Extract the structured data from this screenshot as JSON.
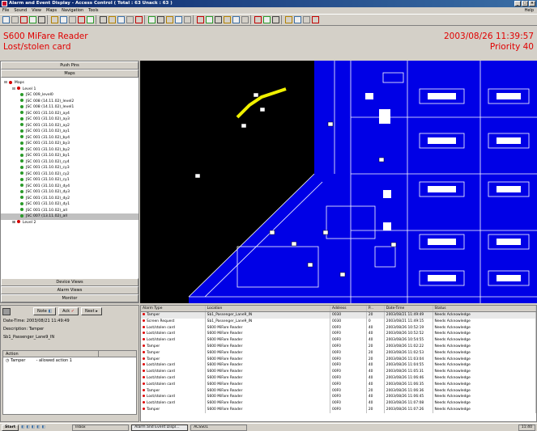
{
  "window": {
    "title": "Alarm and Event Display - Access Control  ( Total : 63  Unack : 63 )",
    "controls": [
      "_",
      "□",
      "×"
    ]
  },
  "menu": {
    "items": [
      "File",
      "Sound",
      "View",
      "Maps",
      "Navigation",
      "Tools"
    ],
    "help": "Help"
  },
  "toolbar": {
    "icons": [
      "acknowledge-icon",
      "print-icon",
      "mute-icon",
      "clear-icon",
      "binoculars-icon",
      "filter-icon",
      "filter-icon",
      "filter-icon",
      "sort-icon",
      "sort-icon",
      "pages-icon",
      "layout-icon",
      "layout-icon",
      "layout-icon",
      "layout-icon",
      "select-icon",
      "zoom-select-icon",
      "zoom-icon",
      "zoom-in-icon",
      "zoom-out-icon",
      "pan-icon",
      "center-icon",
      "nav-icon",
      "nav-icon",
      "nav-icon",
      "nav-icon",
      "map-icon",
      "back-icon",
      "forward-icon",
      "window-icon",
      "window-icon",
      "globe-icon",
      "home-icon"
    ]
  },
  "alarm_header": {
    "device": "S600 MiFare Reader",
    "event": "Lost/stolen card",
    "datetime": "2003/08/26 11:39:57",
    "priority": "Priority 40"
  },
  "left_panel": {
    "top_buttons": [
      "Push Pins",
      "Maps"
    ],
    "bottom_buttons": [
      "Device Views",
      "Alarm Views",
      "Monitor"
    ]
  },
  "tree": [
    {
      "label": "Maps",
      "level": 0,
      "expander": "⊟",
      "color": "#d40000"
    },
    {
      "label": "Level 1",
      "level": 1,
      "expander": "⊟",
      "color": "#d40000"
    },
    {
      "label": "JSC 009_level0",
      "level": 2,
      "color": "#2a9a2a"
    },
    {
      "label": "JSC 008 (14.11.02)_level2",
      "level": 2,
      "color": "#2a9a2a"
    },
    {
      "label": "JSC 008 (14.11.02)_level1",
      "level": 2,
      "color": "#2a9a2a"
    },
    {
      "label": "JSC 001 (31.10.02)_ay4",
      "level": 2,
      "color": "#2a9a2a"
    },
    {
      "label": "JSC 001 (31.10.02)_ay3",
      "level": 2,
      "color": "#2a9a2a"
    },
    {
      "label": "JSC 001 (31.10.02)_ay2",
      "level": 2,
      "color": "#2a9a2a"
    },
    {
      "label": "JSC 001 (31.10.02)_ay1",
      "level": 2,
      "color": "#2a9a2a"
    },
    {
      "label": "JSC 001 (31.10.02)_by4",
      "level": 2,
      "color": "#2a9a2a"
    },
    {
      "label": "JSC 001 (31.10.02)_by3",
      "level": 2,
      "color": "#2a9a2a"
    },
    {
      "label": "JSC 001 (31.10.02)_by2",
      "level": 2,
      "color": "#2a9a2a"
    },
    {
      "label": "JSC 001 (31.10.02)_by1",
      "level": 2,
      "color": "#2a9a2a"
    },
    {
      "label": "JSC 001 (31.10.02)_cy4",
      "level": 2,
      "color": "#2a9a2a"
    },
    {
      "label": "JSC 001 (31.10.02)_cy3",
      "level": 2,
      "color": "#2a9a2a"
    },
    {
      "label": "JSC 001 (31.10.02)_cy2",
      "level": 2,
      "color": "#2a9a2a"
    },
    {
      "label": "JSC 001 (31.10.02)_cy1",
      "level": 2,
      "color": "#2a9a2a"
    },
    {
      "label": "JSC 001 (31.10.02)_dy4",
      "level": 2,
      "color": "#2a9a2a"
    },
    {
      "label": "JSC 001 (31.10.02)_dy3",
      "level": 2,
      "color": "#2a9a2a"
    },
    {
      "label": "JSC 001 (31.10.02)_dy2",
      "level": 2,
      "color": "#2a9a2a"
    },
    {
      "label": "JSC 001 (31.10.02)_dy1",
      "level": 2,
      "color": "#2a9a2a"
    },
    {
      "label": "JSC 001 (31.10.02)_all",
      "level": 2,
      "color": "#2a9a2a"
    },
    {
      "label": "JSC 007 (13.11.02)_all",
      "level": 2,
      "color": "#2a9a2a",
      "selected": true
    },
    {
      "label": "Level 2",
      "level": 1,
      "expander": "⊞",
      "color": "#d40000"
    }
  ],
  "detail": {
    "note_label": "Note",
    "ack_label": "Ack",
    "next_label": "Next",
    "datetime": "Date-Time: 2003/08/21 11:49:49",
    "description": "Description: Tamper",
    "location": "Sb1_Passenger_Lane9_IN",
    "actions_header": "Action",
    "action_row": {
      "name": "Tamper",
      "text": "- allowed action 1"
    }
  },
  "grid": {
    "headers": [
      "Alarm Type",
      "Location",
      "Address",
      "P...",
      "Date-Time",
      "Status"
    ],
    "rows": [
      {
        "type": "Tamper",
        "location": "Sb1_Passenger_Lane9_IN",
        "address": "0030",
        "p": "20",
        "datetime": "2003/08/21 11:49:49",
        "status": "Needs Acknowledge",
        "selected": true
      },
      {
        "type": "Screen Request",
        "location": "Sb1_Passenger_Lane9_IN",
        "address": "0030",
        "p": "0",
        "datetime": "2003/08/21 11:49:15",
        "status": "Needs Acknowledge"
      },
      {
        "type": "Lost/stolen card",
        "location": "S600 MiFare Reader",
        "address": "00F0",
        "p": "40",
        "datetime": "2003/08/26 10:52:19",
        "status": "Needs Acknowledge"
      },
      {
        "type": "Lost/stolen card",
        "location": "S600 MiFare Reader",
        "address": "00F0",
        "p": "40",
        "datetime": "2003/08/26 10:52:52",
        "status": "Needs Acknowledge"
      },
      {
        "type": "Lost/stolen card",
        "location": "S600 MiFare Reader",
        "address": "00F0",
        "p": "40",
        "datetime": "2003/08/26 10:54:55",
        "status": "Needs Acknowledge"
      },
      {
        "type": "Tamper",
        "location": "S600 MiFare Reader",
        "address": "00F0",
        "p": "20",
        "datetime": "2003/08/26 11:02:22",
        "status": "Needs Acknowledge"
      },
      {
        "type": "Tamper",
        "location": "S600 MiFare Reader",
        "address": "00F0",
        "p": "20",
        "datetime": "2003/08/26 11:02:53",
        "status": "Needs Acknowledge"
      },
      {
        "type": "Tamper",
        "location": "S600 MiFare Reader",
        "address": "00F0",
        "p": "20",
        "datetime": "2003/08/26 11:03:04",
        "status": "Needs Acknowledge"
      },
      {
        "type": "Lost/stolen card",
        "location": "S600 MiFare Reader",
        "address": "00F0",
        "p": "40",
        "datetime": "2003/08/26 11:04:55",
        "status": "Needs Acknowledge"
      },
      {
        "type": "Lost/stolen card",
        "location": "S600 MiFare Reader",
        "address": "00F0",
        "p": "40",
        "datetime": "2003/08/26 11:05:31",
        "status": "Needs Acknowledge"
      },
      {
        "type": "Lost/stolen card",
        "location": "S600 MiFare Reader",
        "address": "00F0",
        "p": "40",
        "datetime": "2003/08/26 11:06:46",
        "status": "Needs Acknowledge"
      },
      {
        "type": "Lost/stolen card",
        "location": "S600 MiFare Reader",
        "address": "00F0",
        "p": "40",
        "datetime": "2003/08/26 11:06:35",
        "status": "Needs Acknowledge"
      },
      {
        "type": "Tamper",
        "location": "S600 MiFare Reader",
        "address": "00F0",
        "p": "20",
        "datetime": "2003/08/26 11:06:36",
        "status": "Needs Acknowledge"
      },
      {
        "type": "Lost/stolen card",
        "location": "S600 MiFare Reader",
        "address": "00F0",
        "p": "40",
        "datetime": "2003/08/26 11:06:45",
        "status": "Needs Acknowledge"
      },
      {
        "type": "Lost/stolen card",
        "location": "S600 MiFare Reader",
        "address": "00F0",
        "p": "40",
        "datetime": "2003/08/26 11:07:08",
        "status": "Needs Acknowledge"
      },
      {
        "type": "Tamper",
        "location": "S600 MiFare Reader",
        "address": "00F0",
        "p": "20",
        "datetime": "2003/08/26 11:07:26",
        "status": "Needs Acknowledge"
      }
    ]
  },
  "taskbar": {
    "start": "Start",
    "tasks": [
      "Inbox",
      "Alarm and Event Displ...",
      "ACSS01"
    ],
    "clock": "11:40"
  },
  "colors": {
    "alarm_red": "#e00000",
    "map_bg": "#000000",
    "map_floor": "#0000e6",
    "title_blue": "#0a246a",
    "highlight_yellow": "#f0f000"
  }
}
